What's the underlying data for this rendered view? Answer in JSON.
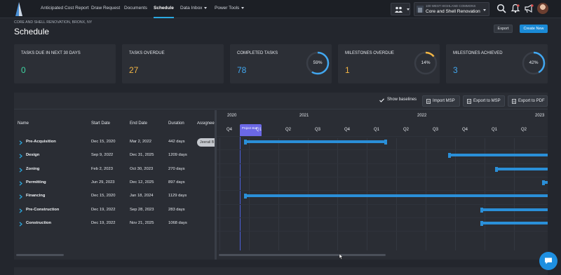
{
  "nav": {
    "items": [
      {
        "label": "Anticipated Cost Report",
        "active": false,
        "dropdown": false
      },
      {
        "label": "Draw Request",
        "active": false,
        "dropdown": false
      },
      {
        "label": "Documents",
        "active": false,
        "dropdown": false
      },
      {
        "label": "Schedule",
        "active": true,
        "dropdown": false
      },
      {
        "label": "Data Inbox",
        "active": false,
        "dropdown": true
      },
      {
        "label": "Power Tools",
        "active": false,
        "dropdown": true
      }
    ],
    "project": {
      "address": "100 WEST HIGHLAND COMMONS",
      "name": "Core and Shell Renovation"
    },
    "icons": [
      "people-icon",
      "search-icon",
      "bell-icon",
      "megaphone-icon",
      "avatar"
    ]
  },
  "header": {
    "breadcrumb": "CORE AND SHELL RENOVATION, BRONX, NY",
    "title": "Schedule",
    "export_label": "Export",
    "create_label": "Create New"
  },
  "stats": [
    {
      "label": "TASKS DUE IN NEXT 30 DAYS",
      "value": "0",
      "color": "#3fd6a3"
    },
    {
      "label": "TASKS OVERDUE",
      "value": "27",
      "color": "#f2b544"
    },
    {
      "label": "COMPLETED TASKS",
      "value": "78",
      "color": "#41a7f0",
      "ring_percent": 59,
      "ring_text": "59%",
      "ring_color": "#41a7f0"
    },
    {
      "label": "MILESTONES OVERDUE",
      "value": "1",
      "color": "#f2b544",
      "ring_percent": 14,
      "ring_text": "14%",
      "ring_color": "#f2b544"
    },
    {
      "label": "MILESTONES ACHIEVED",
      "value": "3",
      "color": "#41a7f0",
      "ring_percent": 42,
      "ring_text": "42%",
      "ring_color": "#41a7f0"
    }
  ],
  "toolbar": {
    "show_baselines": "Show baselines",
    "show_baselines_checked": true,
    "import_msp": "Import MSP",
    "export_msp": "Export to MSP",
    "export_pdf": "Export to PDF"
  },
  "grid": {
    "columns": [
      "Name",
      "Start Date",
      "End Date",
      "Duration",
      "Assignee"
    ],
    "rows": [
      {
        "name": "Pre-Acquisition",
        "start": "Dec 15, 2020",
        "end": "Mar 2, 2022",
        "duration": "442 days",
        "assignee": "Jeerail B"
      },
      {
        "name": "Design",
        "start": "Sep 9, 2022",
        "end": "Dec 31, 2025",
        "duration": "1209 days",
        "assignee": ""
      },
      {
        "name": "Zoning",
        "start": "Feb 2, 2023",
        "end": "Oct 30, 2023",
        "duration": "270 days",
        "assignee": ""
      },
      {
        "name": "Permitting",
        "start": "Jun 29, 2023",
        "end": "Dec 12, 2025",
        "duration": "897 days",
        "assignee": ""
      },
      {
        "name": "Financing",
        "start": "Dec 15, 2020",
        "end": "Jan 18, 2024",
        "duration": "1129 days",
        "assignee": ""
      },
      {
        "name": "Pre-Construction",
        "start": "Dec 19, 2022",
        "end": "Sep 28, 2023",
        "duration": "283 days",
        "assignee": ""
      },
      {
        "name": "Construction",
        "start": "Dec 19, 2022",
        "end": "Nov 21, 2025",
        "duration": "1068 days",
        "assignee": ""
      }
    ]
  },
  "timeline": {
    "years": [
      "2020",
      "2021",
      "2022",
      "2023"
    ],
    "quarters": [
      "Q4",
      "Q1",
      "Q2",
      "Q3",
      "Q4",
      "Q1",
      "Q2",
      "Q3",
      "Q4",
      "Q1",
      "Q2"
    ],
    "today_label": "Project start",
    "bar_color": "#2a8fd8"
  }
}
